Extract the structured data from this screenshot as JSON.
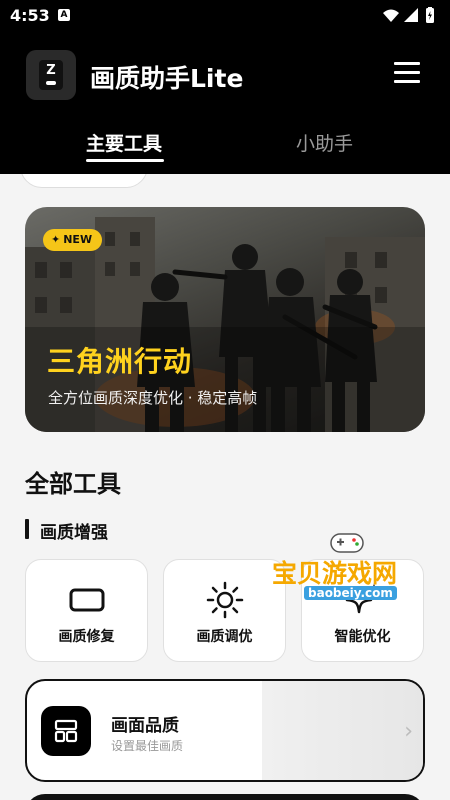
{
  "status_bar": {
    "time": "4:53",
    "notif_icon": "A"
  },
  "app": {
    "title": "画质助手Lite"
  },
  "tabs": [
    {
      "label": "主要工具"
    },
    {
      "label": "小助手"
    }
  ],
  "banner": {
    "badge": "NEW",
    "title": "三角洲行动",
    "subtitle": "全方位画质深度优化 · 稳定高帧"
  },
  "sections": {
    "all_tools": "全部工具",
    "enhance": "画质增强"
  },
  "tools": [
    {
      "label": "画质修复",
      "icon": "rounded-rect-icon"
    },
    {
      "label": "画质调优",
      "icon": "sun-icon"
    },
    {
      "label": "智能优化",
      "icon": "sparkles-icon"
    }
  ],
  "feature": {
    "title": "画面品质",
    "subtitle": "设置最佳画质",
    "icon": "layout-grid-icon"
  },
  "watermark": {
    "text": "宝贝游戏网",
    "url": "baobeiy.com"
  },
  "colors": {
    "accent": "#ffd21e",
    "badge": "#f5c518",
    "dark": "#000000"
  }
}
